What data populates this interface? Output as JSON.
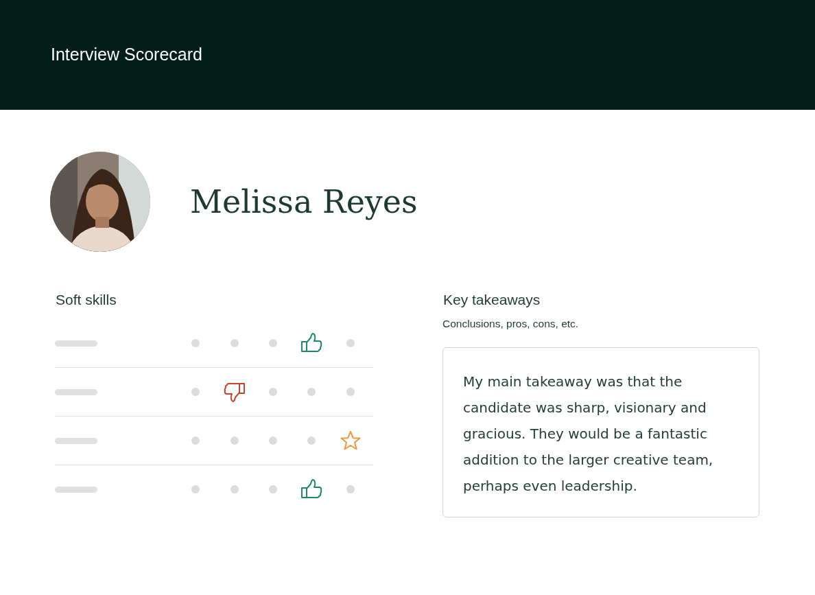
{
  "header": {
    "title": "Interview Scorecard"
  },
  "candidate": {
    "name": "Melissa Reyes"
  },
  "soft_skills": {
    "title": "Soft skills",
    "rows": [
      {
        "kind": "thumbs_up",
        "options": [
          {
            "selected": false
          },
          {
            "selected": false
          },
          {
            "selected": false
          },
          {
            "selected": true
          },
          {
            "selected": false
          }
        ]
      },
      {
        "kind": "thumbs_down",
        "options": [
          {
            "selected": false
          },
          {
            "selected": true
          },
          {
            "selected": false
          },
          {
            "selected": false
          },
          {
            "selected": false
          }
        ]
      },
      {
        "kind": "star",
        "options": [
          {
            "selected": false
          },
          {
            "selected": false
          },
          {
            "selected": false
          },
          {
            "selected": false
          },
          {
            "selected": true
          }
        ]
      },
      {
        "kind": "thumbs_up",
        "options": [
          {
            "selected": false
          },
          {
            "selected": false
          },
          {
            "selected": false
          },
          {
            "selected": true
          },
          {
            "selected": false
          }
        ]
      }
    ]
  },
  "key_takeaways": {
    "title": "Key takeaways",
    "hint": "Conclusions, pros, cons, etc.",
    "value": "My main takeaway was that the candidate was sharp, visionary and gracious. They would be a fantastic addition to the larger creative team, perhaps even leadership."
  }
}
